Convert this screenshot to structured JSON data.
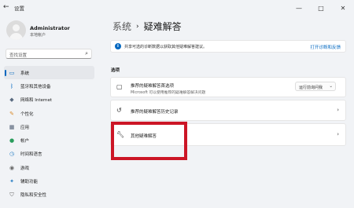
{
  "window": {
    "title": "设置"
  },
  "profile": {
    "name": "Administrator",
    "subtitle": "本地帐户"
  },
  "search": {
    "placeholder": "查找设置"
  },
  "nav": {
    "items": [
      {
        "label": "系统",
        "icon": "monitor-icon",
        "glyph": "▭",
        "color": "#0067c0",
        "active": true
      },
      {
        "label": "蓝牙和其他设备",
        "icon": "bluetooth-icon",
        "glyph": "ᛒ",
        "color": "#0067c0"
      },
      {
        "label": "网络和 Internet",
        "icon": "wifi-icon",
        "glyph": "◆",
        "color": "#5a6b80"
      },
      {
        "label": "个性化",
        "icon": "brush-icon",
        "glyph": "✎",
        "color": "#d98a2a"
      },
      {
        "label": "应用",
        "icon": "apps-icon",
        "glyph": "▦",
        "color": "#4a5a70"
      },
      {
        "label": "帐户",
        "icon": "account-icon",
        "glyph": "●",
        "color": "#2a9d5c"
      },
      {
        "label": "时间和语言",
        "icon": "clock-globe-icon",
        "glyph": "◷",
        "color": "#2a7fc4"
      },
      {
        "label": "游戏",
        "icon": "gamepad-icon",
        "glyph": "◉",
        "color": "#666666"
      },
      {
        "label": "辅助功能",
        "icon": "accessibility-icon",
        "glyph": "✦",
        "color": "#2a7fc4"
      },
      {
        "label": "隐私和安全性",
        "icon": "shield-icon",
        "glyph": "⛉",
        "color": "#666666"
      }
    ]
  },
  "breadcrumb": {
    "parent": "系统",
    "separator": "›",
    "current": "疑难解答"
  },
  "info_bar": {
    "text": "共享可选的诊断数据以获取其他疑难解答建议。",
    "link": "打开诊断和反馈"
  },
  "section": {
    "label": "选项"
  },
  "cards": {
    "preferences": {
      "title": "推荐的疑难解答首选项",
      "subtitle": "Microsoft 可以使用推荐的疑难解答解决问题",
      "dropdown_value": "运行前询问我"
    },
    "history": {
      "title": "推荐的疑难解答历史记录"
    },
    "other": {
      "title": "其他疑难解答"
    }
  }
}
